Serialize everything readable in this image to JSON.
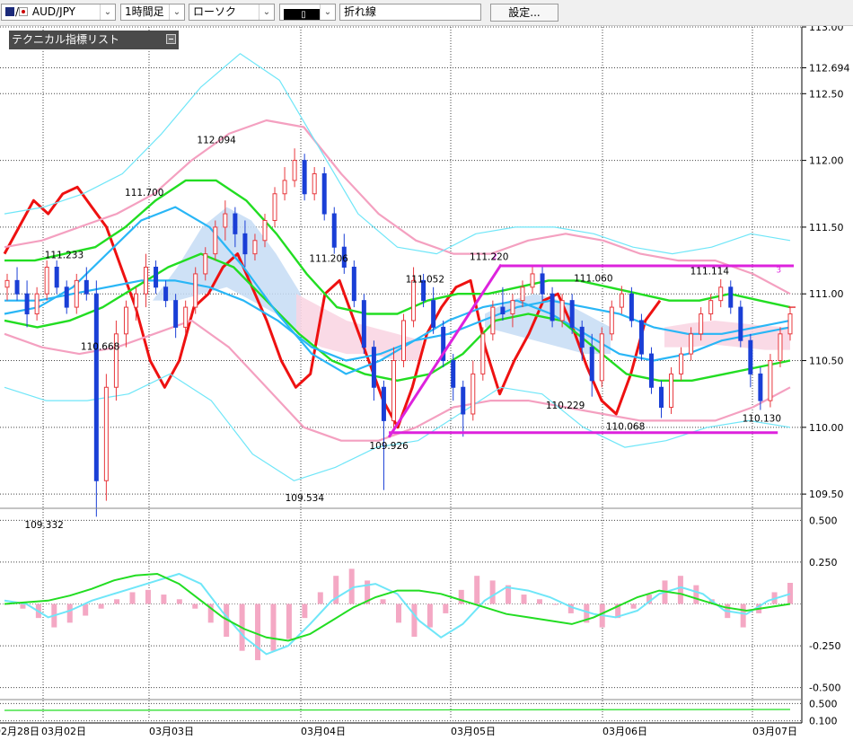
{
  "toolbar": {
    "symbol": "AUD/JPY",
    "symbol_icon": "au-jp-flag-icon",
    "timeframe": "1時間足",
    "chart_style": "ローソク",
    "drawing_tool": "折れ線",
    "settings_label": "設定..."
  },
  "panel": {
    "title": "テクニカル指標リスト"
  },
  "colors": {
    "bull": "#e8383d",
    "bear": "#1a3fd6",
    "red_line": "#ee1111",
    "green_line": "#22dd22",
    "cyan_line": "#29b6f6",
    "pink_line": "#f4a0c0",
    "light_cyan": "#6fe6f8",
    "magenta": "#dd22dd",
    "cloud_blue": "#c5dcf5",
    "cloud_pink": "#f9d3e2"
  },
  "chart_data": [
    {
      "type": "candlestick",
      "name": "AUD/JPY 1時間足",
      "y_range": [
        109.4,
        113.0
      ],
      "y_ticks": [
        "113.00",
        "112.694",
        "112.50",
        "112.00",
        "111.50",
        "111.00",
        "110.50",
        "110.00",
        "109.50"
      ],
      "x_labels": [
        "02月28日",
        "03月02日",
        "03月03日",
        "03月04日",
        "03月05日",
        "03月06日",
        "03月07日"
      ],
      "annotations": [
        {
          "label": "112.094",
          "x": 0.27,
          "y": 112.094,
          "pos": "above"
        },
        {
          "label": "111.700",
          "x": 0.18,
          "y": 111.7,
          "pos": "above"
        },
        {
          "label": "111.233",
          "x": 0.08,
          "y": 111.233,
          "pos": "above"
        },
        {
          "label": "110.668",
          "x": 0.125,
          "y": 110.668,
          "pos": "below"
        },
        {
          "label": "109.332",
          "x": 0.055,
          "y": 109.332,
          "pos": "below"
        },
        {
          "label": "111.206",
          "x": 0.41,
          "y": 111.206,
          "pos": "above"
        },
        {
          "label": "109.534",
          "x": 0.38,
          "y": 109.534,
          "pos": "below"
        },
        {
          "label": "111.052",
          "x": 0.53,
          "y": 111.052,
          "pos": "above"
        },
        {
          "label": "109.926",
          "x": 0.485,
          "y": 109.926,
          "pos": "below"
        },
        {
          "label": "111.220",
          "x": 0.61,
          "y": 111.22,
          "pos": "above"
        },
        {
          "label": "111.060",
          "x": 0.74,
          "y": 111.06,
          "pos": "above"
        },
        {
          "label": "110.229",
          "x": 0.705,
          "y": 110.229,
          "pos": "below"
        },
        {
          "label": "110.068",
          "x": 0.78,
          "y": 110.068,
          "pos": "below"
        },
        {
          "label": "111.114",
          "x": 0.885,
          "y": 111.114,
          "pos": "above"
        },
        {
          "label": "110.130",
          "x": 0.95,
          "y": 110.13,
          "pos": "below"
        }
      ],
      "markers": [
        "2",
        "3"
      ],
      "series_notes": "candles OHLC estimated from the screenshot",
      "candles": [
        [
          111.05,
          111.15,
          110.95,
          111.1
        ],
        [
          111.1,
          111.2,
          110.95,
          111.0
        ],
        [
          111.0,
          111.1,
          110.75,
          110.85
        ],
        [
          110.85,
          111.05,
          110.8,
          111.0
        ],
        [
          111.0,
          111.25,
          110.95,
          111.2
        ],
        [
          111.2,
          111.25,
          111.0,
          111.05
        ],
        [
          111.05,
          111.1,
          110.85,
          110.9
        ],
        [
          110.9,
          111.15,
          110.85,
          111.1
        ],
        [
          111.1,
          111.2,
          110.95,
          111.0
        ],
        [
          111.0,
          111.1,
          109.33,
          109.6
        ],
        [
          109.6,
          110.4,
          109.45,
          110.3
        ],
        [
          110.3,
          110.8,
          110.2,
          110.7
        ],
        [
          110.7,
          110.95,
          110.6,
          110.9
        ],
        [
          110.9,
          111.05,
          110.8,
          111.0
        ],
        [
          111.0,
          111.3,
          110.9,
          111.2
        ],
        [
          111.2,
          111.25,
          111.0,
          111.05
        ],
        [
          111.05,
          111.1,
          110.9,
          110.95
        ],
        [
          110.95,
          111.0,
          110.67,
          110.75
        ],
        [
          110.75,
          110.95,
          110.7,
          110.9
        ],
        [
          110.9,
          111.2,
          110.85,
          111.15
        ],
        [
          111.15,
          111.35,
          111.1,
          111.3
        ],
        [
          111.3,
          111.55,
          111.25,
          111.5
        ],
        [
          111.5,
          111.7,
          111.4,
          111.6
        ],
        [
          111.6,
          111.65,
          111.35,
          111.45
        ],
        [
          111.45,
          111.55,
          111.2,
          111.3
        ],
        [
          111.3,
          111.45,
          111.25,
          111.4
        ],
        [
          111.4,
          111.6,
          111.35,
          111.55
        ],
        [
          111.55,
          111.8,
          111.5,
          111.75
        ],
        [
          111.75,
          111.95,
          111.7,
          111.85
        ],
        [
          111.85,
          112.09,
          111.8,
          112.0
        ],
        [
          112.0,
          112.05,
          111.7,
          111.75
        ],
        [
          111.75,
          111.95,
          111.7,
          111.9
        ],
        [
          111.9,
          111.95,
          111.55,
          111.6
        ],
        [
          111.6,
          111.65,
          111.3,
          111.35
        ],
        [
          111.35,
          111.45,
          111.15,
          111.2
        ],
        [
          111.2,
          111.25,
          110.9,
          110.95
        ],
        [
          110.95,
          111.0,
          110.55,
          110.6
        ],
        [
          110.6,
          110.65,
          110.2,
          110.3
        ],
        [
          110.3,
          110.35,
          109.53,
          110.05
        ],
        [
          110.05,
          110.6,
          110.0,
          110.5
        ],
        [
          110.5,
          110.85,
          110.45,
          110.8
        ],
        [
          110.8,
          111.2,
          110.75,
          111.1
        ],
        [
          111.1,
          111.15,
          110.9,
          110.95
        ],
        [
          110.95,
          111.05,
          110.7,
          110.75
        ],
        [
          110.75,
          110.8,
          110.45,
          110.5
        ],
        [
          110.5,
          110.55,
          110.2,
          110.3
        ],
        [
          110.3,
          110.35,
          109.93,
          110.1
        ],
        [
          110.1,
          110.5,
          110.05,
          110.4
        ],
        [
          110.4,
          110.75,
          110.35,
          110.7
        ],
        [
          110.7,
          110.95,
          110.65,
          110.9
        ],
        [
          110.9,
          111.05,
          110.8,
          110.85
        ],
        [
          110.85,
          111.0,
          110.75,
          110.95
        ],
        [
          110.95,
          111.1,
          110.9,
          111.05
        ],
        [
          111.05,
          111.22,
          111.0,
          111.15
        ],
        [
          111.15,
          111.2,
          110.95,
          111.0
        ],
        [
          111.0,
          111.05,
          110.75,
          110.8
        ],
        [
          110.8,
          111.0,
          110.75,
          110.95
        ],
        [
          110.95,
          111.0,
          110.7,
          110.75
        ],
        [
          110.75,
          110.8,
          110.5,
          110.6
        ],
        [
          110.6,
          110.7,
          110.23,
          110.35
        ],
        [
          110.35,
          110.75,
          110.3,
          110.7
        ],
        [
          110.7,
          110.95,
          110.65,
          110.9
        ],
        [
          110.9,
          111.06,
          110.85,
          111.0
        ],
        [
          111.0,
          111.05,
          110.75,
          110.8
        ],
        [
          110.8,
          110.85,
          110.5,
          110.55
        ],
        [
          110.55,
          110.6,
          110.25,
          110.3
        ],
        [
          110.3,
          110.35,
          110.07,
          110.15
        ],
        [
          110.15,
          110.45,
          110.1,
          110.4
        ],
        [
          110.4,
          110.6,
          110.35,
          110.55
        ],
        [
          110.55,
          110.75,
          110.5,
          110.7
        ],
        [
          110.7,
          110.9,
          110.65,
          110.85
        ],
        [
          110.85,
          111.0,
          110.8,
          110.95
        ],
        [
          110.95,
          111.11,
          110.9,
          111.05
        ],
        [
          111.05,
          111.1,
          110.85,
          110.9
        ],
        [
          110.9,
          110.95,
          110.6,
          110.65
        ],
        [
          110.65,
          110.7,
          110.3,
          110.4
        ],
        [
          110.4,
          110.45,
          110.13,
          110.2
        ],
        [
          110.2,
          110.55,
          110.15,
          110.5
        ],
        [
          110.5,
          110.75,
          110.45,
          110.7
        ],
        [
          110.7,
          110.9,
          110.65,
          110.85
        ]
      ],
      "lines": [
        {
          "color_key": "red_line",
          "values": [
            111.3,
            111.5,
            111.7,
            111.6,
            111.75,
            111.8,
            111.65,
            111.5,
            111.2,
            110.9,
            110.5,
            110.3,
            110.5,
            110.9,
            111.0,
            111.2,
            111.3,
            111.05,
            110.8,
            110.5,
            110.3,
            110.4,
            111.0,
            111.1,
            110.8,
            110.5,
            110.2,
            110.0,
            110.3,
            110.7,
            110.9,
            111.05,
            111.1,
            110.6,
            110.25,
            110.5,
            110.7,
            110.95,
            111.0,
            110.75,
            110.45,
            110.2,
            110.1,
            110.4,
            110.8,
            110.95
          ]
        },
        {
          "color_key": "green_line",
          "values": [
            111.25,
            111.25,
            111.3,
            111.35,
            111.5,
            111.7,
            111.85,
            111.85,
            111.7,
            111.45,
            111.15,
            110.9,
            110.85,
            110.85,
            110.95,
            111.0,
            111.0,
            111.05,
            111.1,
            111.1,
            111.05,
            111.0,
            110.95,
            110.95,
            111.0,
            110.95,
            110.9
          ]
        },
        {
          "color_key": "green_line",
          "values": [
            110.8,
            110.75,
            110.8,
            110.9,
            111.05,
            111.2,
            111.3,
            111.2,
            110.95,
            110.7,
            110.5,
            110.4,
            110.35,
            110.4,
            110.55,
            110.8,
            110.85,
            110.8,
            110.6,
            110.4,
            110.35,
            110.35,
            110.4,
            110.45,
            110.5
          ]
        },
        {
          "color_key": "cyan_line",
          "values": [
            110.95,
            110.95,
            111.0,
            111.05,
            111.1,
            111.1,
            111.05,
            110.95,
            110.8,
            110.6,
            110.5,
            110.55,
            110.65,
            110.7,
            110.8,
            110.9,
            110.95,
            110.9,
            110.85,
            110.75,
            110.7,
            110.7,
            110.75,
            110.8
          ]
        },
        {
          "color_key": "cyan_line",
          "values": [
            110.85,
            110.9,
            111.05,
            111.3,
            111.55,
            111.65,
            111.5,
            111.2,
            110.85,
            110.55,
            110.4,
            110.5,
            110.65,
            110.8,
            110.9,
            110.95,
            110.85,
            110.7,
            110.55,
            110.5,
            110.55,
            110.65,
            110.7,
            110.75
          ]
        },
        {
          "color_key": "pink_line",
          "values": [
            111.35,
            111.4,
            111.5,
            111.6,
            111.75,
            112.0,
            112.2,
            112.3,
            112.25,
            111.9,
            111.6,
            111.4,
            111.3,
            111.3,
            111.4,
            111.45,
            111.4,
            111.3,
            111.25,
            111.25,
            111.15,
            111.0
          ]
        },
        {
          "color_key": "pink_line",
          "values": [
            110.7,
            110.6,
            110.55,
            110.6,
            110.7,
            110.8,
            110.6,
            110.3,
            110.0,
            109.9,
            109.9,
            110.0,
            110.15,
            110.2,
            110.2,
            110.15,
            110.1,
            110.05,
            110.05,
            110.05,
            110.15,
            110.3
          ]
        },
        {
          "color_key": "light_cyan",
          "values": [
            111.6,
            111.65,
            111.75,
            111.9,
            112.2,
            112.55,
            112.8,
            112.6,
            112.1,
            111.6,
            111.35,
            111.3,
            111.45,
            111.5,
            111.5,
            111.45,
            111.35,
            111.3,
            111.35,
            111.45,
            111.4
          ]
        },
        {
          "color_key": "light_cyan",
          "values": [
            110.3,
            110.2,
            110.2,
            110.25,
            110.4,
            110.2,
            109.8,
            109.6,
            109.7,
            109.85,
            109.9,
            110.1,
            110.3,
            110.25,
            110.0,
            109.85,
            109.9,
            110.0,
            110.05,
            110.0
          ]
        }
      ],
      "trendlines": [
        {
          "from": [
            0.485,
            109.926
          ],
          "to": [
            0.625,
            111.22
          ]
        },
        {
          "from": [
            0.485,
            109.96
          ],
          "to": [
            0.97,
            109.96
          ]
        },
        {
          "from": [
            0.625,
            111.21
          ],
          "to": [
            0.99,
            111.21
          ]
        }
      ]
    },
    {
      "type": "macd",
      "y_ticks": [
        "0.500",
        "0.250",
        "-0.250",
        "-0.500"
      ],
      "histogram": [
        0.0,
        -0.02,
        -0.06,
        -0.1,
        -0.08,
        -0.05,
        -0.02,
        0.02,
        0.05,
        0.06,
        0.04,
        0.02,
        -0.02,
        -0.08,
        -0.14,
        -0.2,
        -0.24,
        -0.2,
        -0.15,
        -0.06,
        0.05,
        0.12,
        0.15,
        0.1,
        0.02,
        -0.08,
        -0.14,
        -0.1,
        -0.04,
        0.06,
        0.12,
        0.1,
        0.08,
        0.04,
        0.02,
        0.0,
        -0.04,
        -0.08,
        -0.1,
        -0.06,
        -0.02,
        0.04,
        0.1,
        0.12,
        0.08,
        0.02,
        -0.06,
        -0.1,
        -0.04,
        0.05,
        0.09
      ],
      "macd_line": [
        0.02,
        0.0,
        -0.08,
        -0.04,
        0.02,
        0.06,
        0.1,
        0.14,
        0.18,
        0.12,
        -0.05,
        -0.2,
        -0.3,
        -0.25,
        -0.12,
        0.02,
        0.1,
        0.12,
        0.06,
        -0.1,
        -0.2,
        -0.12,
        0.02,
        0.1,
        0.08,
        0.04,
        -0.02,
        -0.06,
        -0.08,
        -0.04,
        0.06,
        0.1,
        0.06,
        -0.04,
        -0.06,
        0.02,
        0.06
      ],
      "signal_line": [
        0.0,
        0.01,
        0.02,
        0.05,
        0.09,
        0.14,
        0.17,
        0.18,
        0.12,
        0.02,
        -0.08,
        -0.15,
        -0.2,
        -0.22,
        -0.18,
        -0.1,
        -0.02,
        0.04,
        0.08,
        0.08,
        0.06,
        0.02,
        -0.02,
        -0.06,
        -0.08,
        -0.1,
        -0.12,
        -0.08,
        -0.02,
        0.04,
        0.08,
        0.06,
        0.02,
        -0.02,
        -0.04,
        -0.02,
        0.0
      ]
    },
    {
      "type": "oscillator",
      "y_ticks": [
        "0.500",
        "0.100"
      ]
    }
  ]
}
